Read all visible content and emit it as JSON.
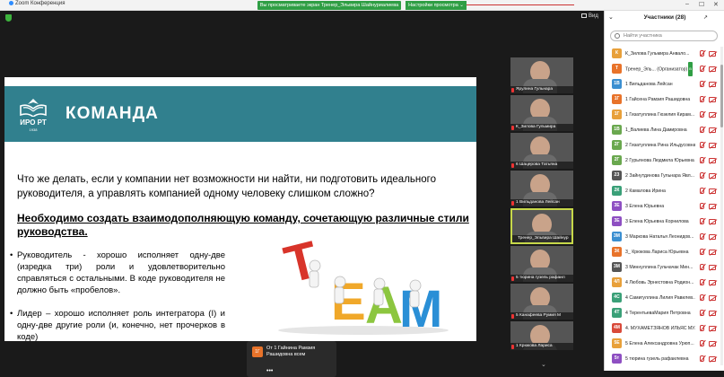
{
  "titlebar": {
    "app_name": "Zoom Конференция",
    "share_banner": "Вы просматриваете экран Тренер_Эльвира Шайнуриалиева",
    "share_settings": "Настройки просмотра ⌄",
    "win_min": "–",
    "win_max": "☐",
    "win_close": "✕"
  },
  "meeting": {
    "view_label": "Вид"
  },
  "slide": {
    "logo_text": "ИРО РТ",
    "logo_year": "1938",
    "title": "КОМАНДА",
    "question": "Что же делать, если у компании нет возможности ни найти, ни подготовить идеального руководителя, а управлять компанией одному человеку слишком сложно?",
    "need": "Необходимо создать взаимодополняющую команду, сочетающую различные стили руководства.",
    "bullets": [
      "Руководитель - хорошо исполняет одну-две (изредка три) роли и удовлетворительно справляться с остальными. В коде руководителя не должно быть «пробелов».",
      "Лидер – хорошо исполняет роль интегратора (I) и одну-две другие роли (и, конечно, нет прочерков в коде)"
    ],
    "bullet_mark": "•",
    "art_word": "TEAM"
  },
  "thumbnails": [
    {
      "name": "Ярулина Гульнара"
    },
    {
      "name": "К_Зилова Гульмира"
    },
    {
      "name": "6 Шацерова Татьяна"
    },
    {
      "name": "1 Вильданова Лейсан"
    },
    {
      "name": "Тренер_Эльвира Шайнур"
    },
    {
      "name": "5 тюрина гузель рафаил"
    },
    {
      "name": "5 Канафеева Румия М"
    },
    {
      "name": "1 Крюкова Лариса"
    }
  ],
  "scroll_indicator": "⌄",
  "chat": {
    "avatar": "1Г",
    "message": "От 1 Гайнина Рамзия Рашидовна всем",
    "dots": "•••"
  },
  "panel": {
    "title": "Участники (28)",
    "chevron": "⌄",
    "popout": "↗",
    "search_placeholder": "Найти участника",
    "participants": [
      {
        "initials": "К",
        "name": "К_Зилова Гульмира Анвало...",
        "color": "#e8a03a"
      },
      {
        "initials": "Т",
        "name": "Тренер_Эль... (Организатор)",
        "color": "#e8732a",
        "badge": "В"
      },
      {
        "initials": "1В",
        "name": "1 Вильданова Лейсан",
        "color": "#3b8fd1"
      },
      {
        "initials": "1Г",
        "name": "1 Гайсена Рамзия Рашидовна",
        "color": "#e8732a"
      },
      {
        "initials": "1Г",
        "name": "1 Гизатуллина Гюзелия Кирам...",
        "color": "#e8a03a"
      },
      {
        "initials": "1В",
        "name": "1_Валиева Лина Дамировна",
        "color": "#6aa84f"
      },
      {
        "initials": "2Г",
        "name": "2 Гизатуллина Рина Ильдусовна",
        "color": "#6aa84f"
      },
      {
        "initials": "2Г",
        "name": "2 Гурьянова Людмила Юрьевна",
        "color": "#6aa84f"
      },
      {
        "initials": "2З",
        "name": "2 Зайнутдинова Гульнара Явл...",
        "color": "#555"
      },
      {
        "initials": "2К",
        "name": "2 Камалова Ирина",
        "color": "#3aa078"
      },
      {
        "initials": "3Е",
        "name": "3 Елена Юрьевна",
        "color": "#8e4fc2"
      },
      {
        "initials": "3Е",
        "name": "3 Елена Юрьевна Корнилова",
        "color": "#8e4fc2"
      },
      {
        "initials": "3М",
        "name": "3 Маркова Наталья Леонидов...",
        "color": "#3b8fd1"
      },
      {
        "initials": "3К",
        "name": "3_ Крюкова Лариса Юрьевна",
        "color": "#e8732a"
      },
      {
        "initials": "3М",
        "name": "3 Миннуллина Гульчачак Мин...",
        "color": "#555"
      },
      {
        "initials": "4Л",
        "name": "4 Любовь Эрнестовна Родион...",
        "color": "#e8a03a"
      },
      {
        "initials": "4С",
        "name": "4 Самигуллина Лилия Равилев...",
        "color": "#3aa078"
      },
      {
        "initials": "4Т",
        "name": "4 ТерентьеваМария Петровна",
        "color": "#3aa078"
      },
      {
        "initials": "4М",
        "name": "4. МУХАМЕТЗЯНОВ ИЛЬЯС МУ...",
        "color": "#d94a3a"
      },
      {
        "initials": "5Е",
        "name": "5 Елена Александровна Урюп...",
        "color": "#e8a03a"
      },
      {
        "initials": "5т",
        "name": "5 тюрина гузель рафаилевна",
        "color": "#8e4fc2"
      }
    ]
  }
}
